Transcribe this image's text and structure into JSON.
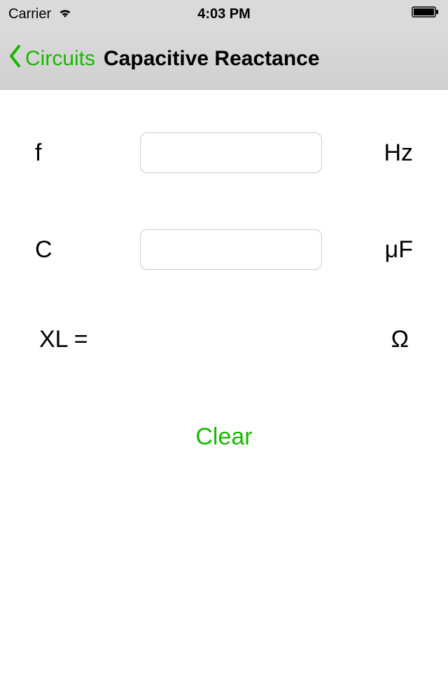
{
  "statusBar": {
    "carrier": "Carrier",
    "time": "4:03 PM"
  },
  "nav": {
    "backLabel": "Circuits",
    "title": "Capacitive Reactance"
  },
  "rows": {
    "frequency": {
      "label": "f",
      "value": "",
      "unit": "Hz"
    },
    "capacitance": {
      "label": "C",
      "value": "",
      "unit": "μF"
    }
  },
  "result": {
    "label": "XL =",
    "value": "",
    "unit": "Ω"
  },
  "buttons": {
    "clear": "Clear"
  },
  "colors": {
    "accent": "#17b800"
  }
}
